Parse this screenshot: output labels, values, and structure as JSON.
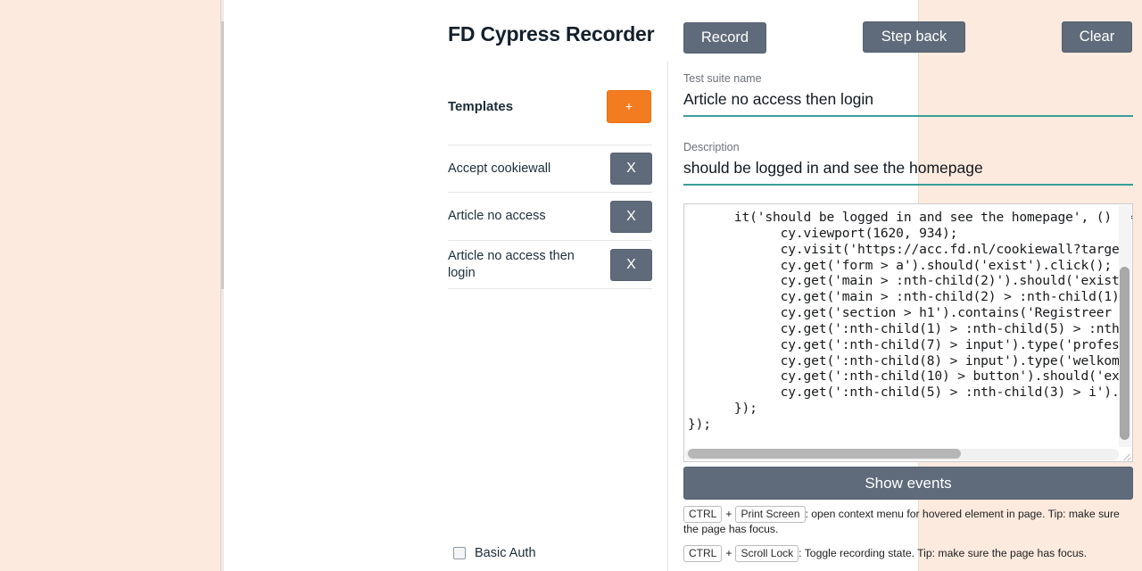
{
  "theme": {
    "page_background": "#fdeade",
    "panel_background": "#ffffff",
    "button_slate": "#5f6b7a",
    "accent_orange": "#f47c20",
    "underline_teal": "#3a9e98"
  },
  "header": {
    "app_title": "FD Cypress Recorder",
    "buttons": {
      "record": "Record",
      "step_back": "Step back",
      "clear": "Clear"
    }
  },
  "sidebar": {
    "templates_label": "Templates",
    "add_button_label": "+",
    "delete_button_label": "X",
    "items": [
      {
        "label": "Accept cookiewall"
      },
      {
        "label": "Article no access"
      },
      {
        "label": "Article no access then login"
      }
    ],
    "basic_auth_label": "Basic Auth",
    "basic_auth_checked": false
  },
  "form": {
    "suite": {
      "label": "Test suite name",
      "value": "Article no access then login"
    },
    "description": {
      "label": "Description",
      "value": "should be logged in and see the homepage"
    }
  },
  "editor": {
    "code": "      it('should be logged in and see the homepage', () =>\n            cy.viewport(1620, 934);\n            cy.visit('https://acc.fd.nl/cookiewall?targe\n            cy.get('form > a').should('exist').click();\n            cy.get('main > :nth-child(2)').should('exist\n            cy.get('main > :nth-child(2) > :nth-child(1)\n            cy.get('section > h1').contains('Registreer\n            cy.get(':nth-child(1) > :nth-child(5) > :nth\n            cy.get(':nth-child(7) > input').type('profes\n            cy.get(':nth-child(8) > input').type('welkom\n            cy.get(':nth-child(10) > button').should('ex\n            cy.get(':nth-child(5) > :nth-child(3) > i').\n      });\n});",
    "horizontal_scroll_percent": 63,
    "vertical_scroll_percent": 26
  },
  "show_events_label": "Show events",
  "hints": [
    {
      "key1": "CTRL",
      "plus": "+",
      "key2": "Print Screen",
      "text": ": open context menu for hovered element in page. Tip: make sure the page has focus."
    },
    {
      "key1": "CTRL",
      "plus": "+",
      "key2": "Scroll Lock",
      "text": ": Toggle recording state. Tip: make sure the page has focus."
    }
  ]
}
